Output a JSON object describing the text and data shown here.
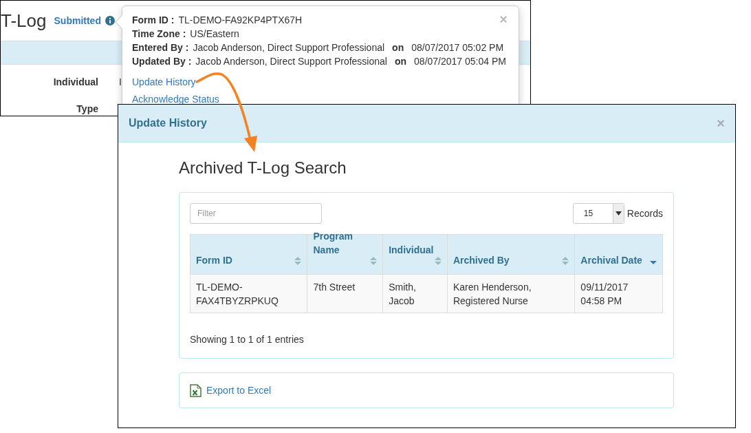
{
  "background_page": {
    "title": "T-Log",
    "status": "Submitted",
    "fields": [
      {
        "label": "Individual",
        "value": "I"
      },
      {
        "label": "Type"
      }
    ]
  },
  "popover": {
    "close": "×",
    "details": [
      {
        "label": "Form ID :",
        "value": "TL-DEMO-FA92KP4PTX67H"
      },
      {
        "label": "Time Zone :",
        "value": "US/Eastern"
      },
      {
        "label": "Entered By :",
        "value": "Jacob Anderson, Direct Support Professional",
        "on": "on",
        "date": "08/07/2017 05:02 PM"
      },
      {
        "label": "Updated By :",
        "value": "Jacob Anderson, Direct Support Professional",
        "on": "on",
        "date": "08/07/2017 05:04 PM"
      }
    ],
    "links": [
      "Update History",
      "Acknowledge Status"
    ]
  },
  "dialog": {
    "title": "Update History",
    "close": "×",
    "heading": "Archived T-Log Search",
    "filter": {
      "placeholder": "Filter"
    },
    "page_size": {
      "value": "15",
      "label": "Records"
    },
    "table": {
      "columns": [
        {
          "label": "Form ID",
          "sorted": false
        },
        {
          "label": "Program Name",
          "sorted": false
        },
        {
          "label": "Individual",
          "sorted": false
        },
        {
          "label": "Archived By",
          "sorted": false
        },
        {
          "label": "Archival Date",
          "sorted": true
        }
      ],
      "rows": [
        [
          "TL-DEMO-FAX4TBYZRPKUQ",
          "7th Street",
          "Smith, Jacob",
          "Karen Henderson, Registered Nurse",
          "09/11/2017 04:58 PM"
        ]
      ]
    },
    "info": "Showing 1 to 1 of 1 entries",
    "export": "Export to Excel"
  }
}
